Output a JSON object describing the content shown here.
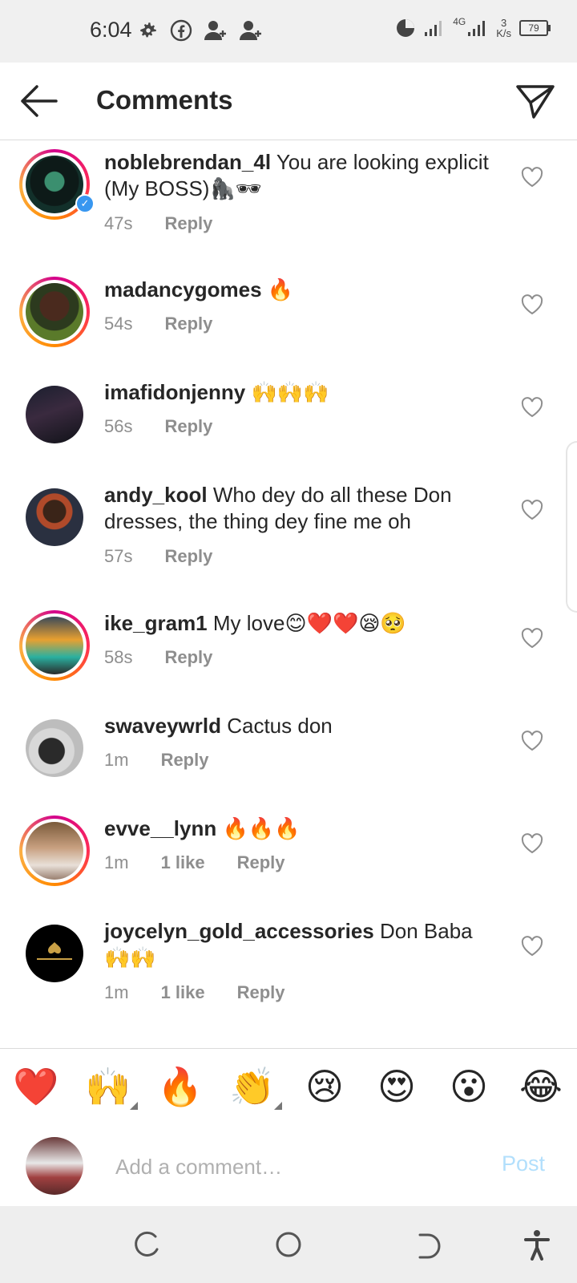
{
  "status_bar": {
    "time": "6:04",
    "network": "4G",
    "speed_value": "3",
    "speed_unit": "K/s",
    "battery": "79"
  },
  "header": {
    "title": "Comments"
  },
  "comments": [
    {
      "username": "noblebrendan_4l",
      "text": "You are looking explicit (My BOSS)🦍🕶",
      "time": "47s",
      "likes": "",
      "reply": "Reply",
      "ring": true
    },
    {
      "username": "madancygomes",
      "text": "🔥",
      "time": "54s",
      "likes": "",
      "reply": "Reply",
      "ring": true
    },
    {
      "username": "imafidonjenny",
      "text": "🙌🙌🙌",
      "time": "56s",
      "likes": "",
      "reply": "Reply",
      "ring": false
    },
    {
      "username": "andy_kool",
      "text": "Who dey do all these Don dresses, the thing dey fine me oh",
      "time": "57s",
      "likes": "",
      "reply": "Reply",
      "ring": false
    },
    {
      "username": "ike_gram1",
      "text": "My love😊❤️❤️😪🥺",
      "time": "58s",
      "likes": "",
      "reply": "Reply",
      "ring": true
    },
    {
      "username": "swaveywrld",
      "text": "Cactus don",
      "time": "1m",
      "likes": "",
      "reply": "Reply",
      "ring": false
    },
    {
      "username": "evve__lynn",
      "text": "🔥🔥🔥",
      "time": "1m",
      "likes": "1 like",
      "reply": "Reply",
      "ring": true
    },
    {
      "username": "joycelyn_gold_accessories",
      "text": "Don Baba 🙌🙌",
      "time": "1m",
      "likes": "1 like",
      "reply": "Reply",
      "ring": false
    }
  ],
  "emoji_bar": [
    "❤️",
    "🙌",
    "🔥",
    "👏",
    "😢",
    "😍",
    "😮",
    "😂"
  ],
  "composer": {
    "placeholder": "Add a comment…",
    "post_label": "Post"
  },
  "colors": {
    "accent_post": "#b2dffc",
    "meta_gray": "#8e8e8e",
    "verified_blue": "#3897f0"
  }
}
